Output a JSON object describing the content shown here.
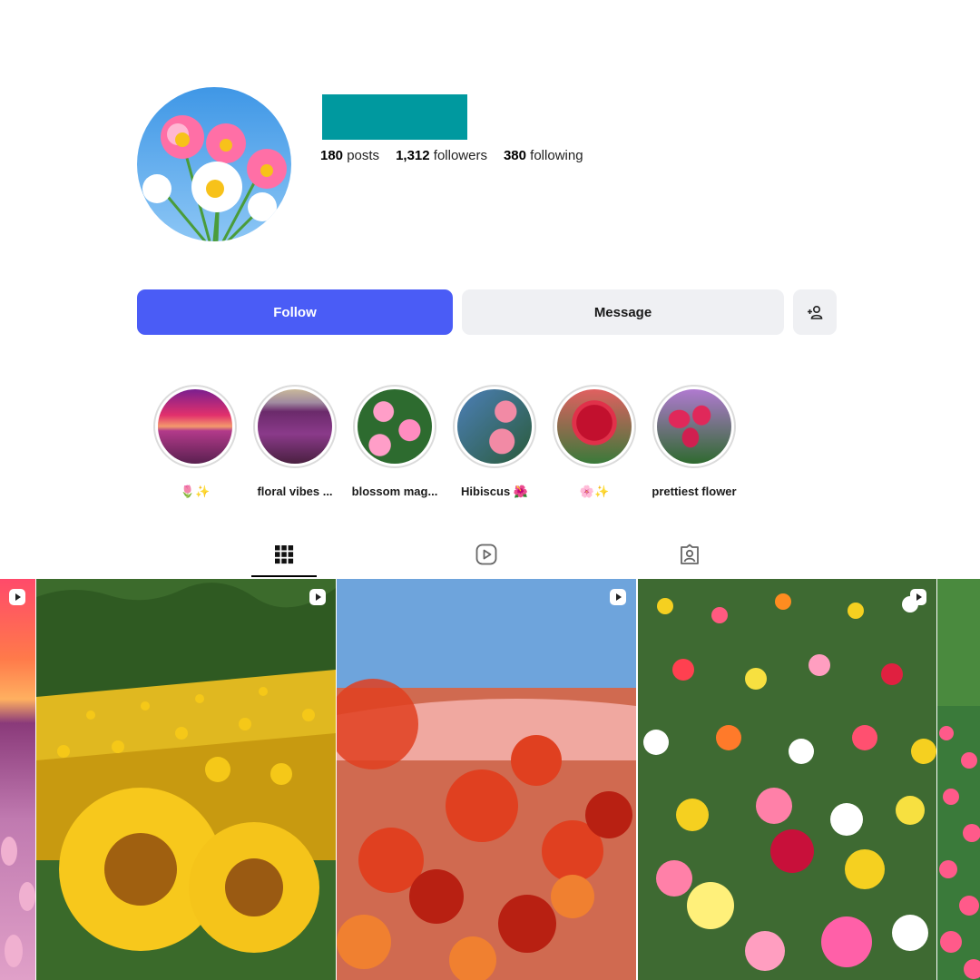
{
  "colors": {
    "accent": "#4a5cf6",
    "username_block": "#00999f",
    "button_secondary": "#eff0f3"
  },
  "profile": {
    "posts_count": "180",
    "posts_label": "posts",
    "followers_count": "1,312",
    "followers_label": "followers",
    "following_count": "380",
    "following_label": "following"
  },
  "actions": {
    "follow_label": "Follow",
    "message_label": "Message",
    "add_icon": "person-add-icon"
  },
  "highlights": [
    {
      "label": "🌷✨"
    },
    {
      "label": "floral vibes ..."
    },
    {
      "label": "blossom mag..."
    },
    {
      "label": "Hibiscus 🌺"
    },
    {
      "label": "🌸✨"
    },
    {
      "label": "prettiest flower"
    }
  ],
  "tabs": [
    {
      "icon": "grid-icon",
      "active": true
    },
    {
      "icon": "reels-icon",
      "active": false
    },
    {
      "icon": "tagged-icon",
      "active": false
    }
  ],
  "posts": [
    {
      "subject": "sunset tulip field",
      "reel": true
    },
    {
      "subject": "sunflower field",
      "reel": true
    },
    {
      "subject": "ranunculus field",
      "reel": true
    },
    {
      "subject": "mixed flower field",
      "reel": true
    },
    {
      "subject": "pink flower garden",
      "reel": false
    }
  ]
}
